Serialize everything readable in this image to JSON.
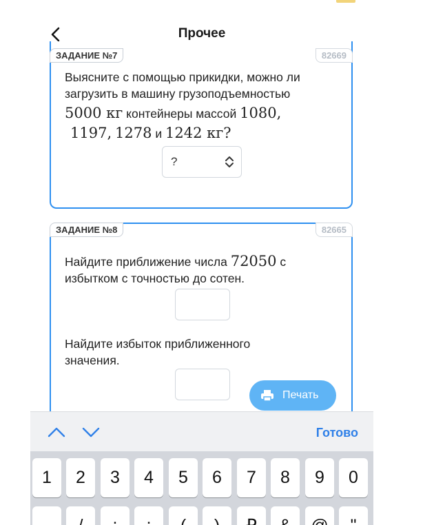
{
  "nav": {
    "title": "Прочее"
  },
  "task7": {
    "label": "ЗАДАНИЕ №7",
    "id": "82669",
    "line1": "Выясните с помощью прикидки, можно ли",
    "line2": "загрузить в машину грузоподъемностью",
    "capacity": "5000 кг",
    "containers_text": "контейнеры массой",
    "mass1": "1080,",
    "mass2": "1197,",
    "mass3": "1278",
    "and": "и",
    "mass4": "1242 кг?",
    "select_value": "?"
  },
  "task8": {
    "label": "ЗАДАНИЕ №8",
    "id": "82665",
    "q1_prefix": "Найдите приближение числа",
    "q1_number": "72050",
    "q1_suffix": "с",
    "q1_line2": "избытком с точностью до сотен.",
    "q2_line1": "Найдите избыток приближенного",
    "q2_line2": "значения.",
    "print_label": "Печать"
  },
  "keyboard": {
    "done_label": "Готово",
    "row1": [
      "1",
      "2",
      "3",
      "4",
      "5",
      "6",
      "7",
      "8",
      "9",
      "0"
    ],
    "row2": [
      "-",
      "/",
      ":",
      ";",
      "(",
      ")",
      "₽",
      "&",
      "@",
      "\""
    ]
  },
  "colors": {
    "accent": "#2d8ff0",
    "print": "#5fb4f5",
    "done": "#2f80e8"
  }
}
